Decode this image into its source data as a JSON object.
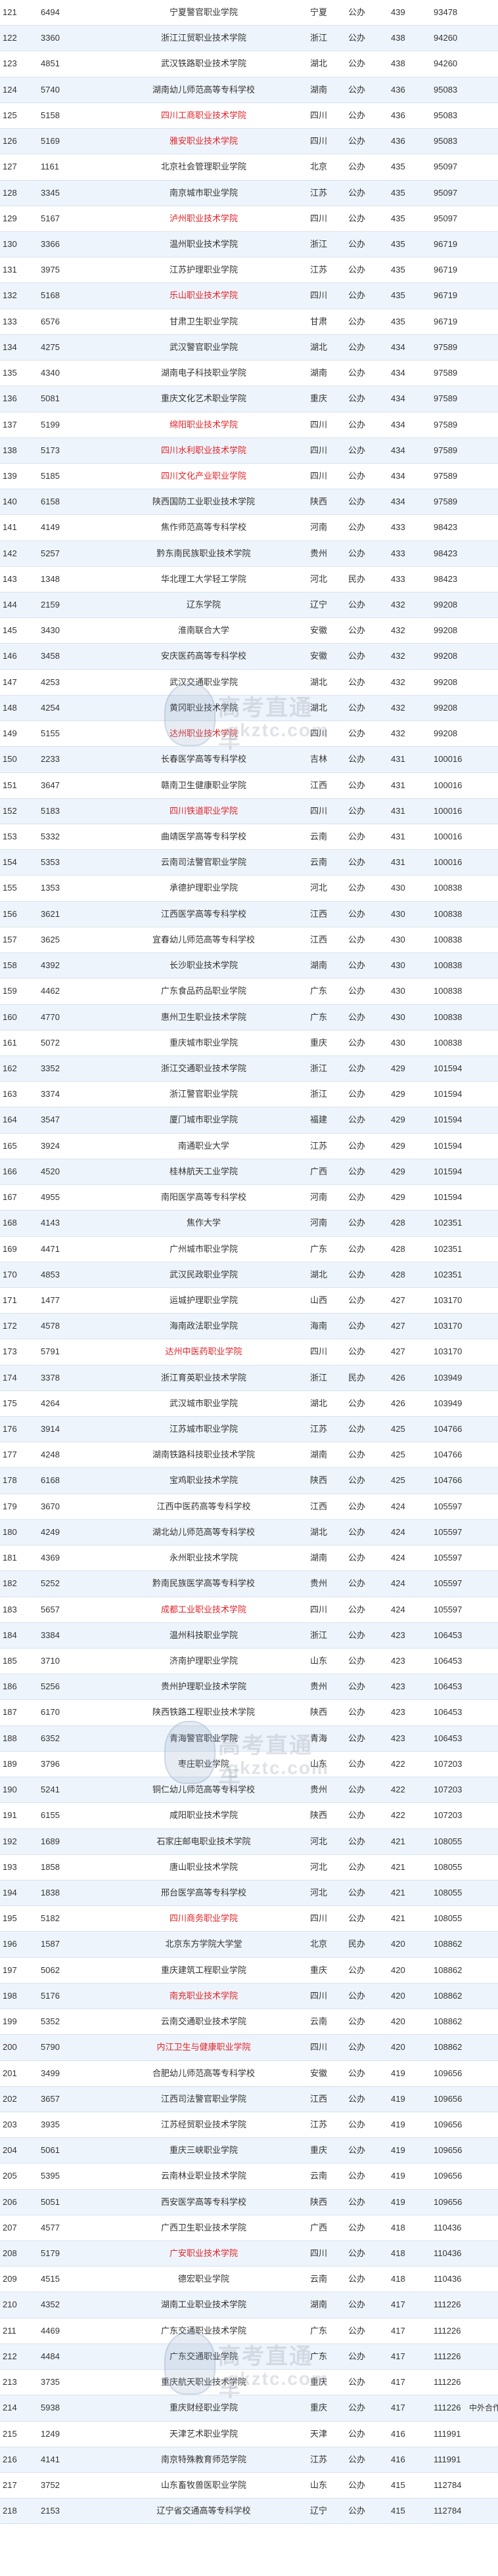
{
  "watermark": {
    "line1": "高考直通车",
    "line2": "gkztc.com"
  },
  "rows": [
    [
      "121",
      "6494",
      "宁夏警官职业学院",
      "宁夏",
      "公办",
      "439",
      "93478",
      "",
      false
    ],
    [
      "122",
      "3360",
      "浙江江贸职业技术学院",
      "浙江",
      "公办",
      "438",
      "94260",
      "",
      false
    ],
    [
      "123",
      "4851",
      "武汉铁路职业技术学院",
      "湖北",
      "公办",
      "438",
      "94260",
      "",
      false
    ],
    [
      "124",
      "5740",
      "湖南幼儿师范高等专科学校",
      "湖南",
      "公办",
      "436",
      "95083",
      "",
      false
    ],
    [
      "125",
      "5158",
      "四川工商职业技术学院",
      "四川",
      "公办",
      "436",
      "95083",
      "",
      true
    ],
    [
      "126",
      "5169",
      "雅安职业技术学院",
      "四川",
      "公办",
      "436",
      "95083",
      "",
      true
    ],
    [
      "127",
      "1161",
      "北京社会管理职业学院",
      "北京",
      "公办",
      "435",
      "95097",
      "",
      false
    ],
    [
      "128",
      "3345",
      "南京城市职业学院",
      "江苏",
      "公办",
      "435",
      "95097",
      "",
      false
    ],
    [
      "129",
      "5167",
      "泸州职业技术学院",
      "四川",
      "公办",
      "435",
      "95097",
      "",
      true
    ],
    [
      "130",
      "3366",
      "温州职业技术学院",
      "浙江",
      "公办",
      "435",
      "96719",
      "",
      false
    ],
    [
      "131",
      "3975",
      "江苏护理职业学院",
      "江苏",
      "公办",
      "435",
      "96719",
      "",
      false
    ],
    [
      "132",
      "5168",
      "乐山职业技术学院",
      "四川",
      "公办",
      "435",
      "96719",
      "",
      true
    ],
    [
      "133",
      "6576",
      "甘肃卫生职业学院",
      "甘肃",
      "公办",
      "435",
      "96719",
      "",
      false
    ],
    [
      "134",
      "4275",
      "武汉警官职业学院",
      "湖北",
      "公办",
      "434",
      "97589",
      "",
      false
    ],
    [
      "135",
      "4340",
      "湖南电子科技职业学院",
      "湖南",
      "公办",
      "434",
      "97589",
      "",
      false
    ],
    [
      "136",
      "5081",
      "重庆文化艺术职业学院",
      "重庆",
      "公办",
      "434",
      "97589",
      "",
      false
    ],
    [
      "137",
      "5199",
      "绵阳职业技术学院",
      "四川",
      "公办",
      "434",
      "97589",
      "",
      true
    ],
    [
      "138",
      "5173",
      "四川水利职业技术学院",
      "四川",
      "公办",
      "434",
      "97589",
      "",
      true
    ],
    [
      "139",
      "5185",
      "四川文化产业职业学院",
      "四川",
      "公办",
      "434",
      "97589",
      "",
      true
    ],
    [
      "140",
      "6158",
      "陕西国防工业职业技术学院",
      "陕西",
      "公办",
      "434",
      "97589",
      "",
      false
    ],
    [
      "141",
      "4149",
      "焦作师范高等专科学校",
      "河南",
      "公办",
      "433",
      "98423",
      "",
      false
    ],
    [
      "142",
      "5257",
      "黔东南民族职业技术学院",
      "贵州",
      "公办",
      "433",
      "98423",
      "",
      false
    ],
    [
      "143",
      "1348",
      "华北理工大学轻工学院",
      "河北",
      "民办",
      "433",
      "98423",
      "",
      false
    ],
    [
      "144",
      "2159",
      "辽东学院",
      "辽宁",
      "公办",
      "432",
      "99208",
      "",
      false
    ],
    [
      "145",
      "3430",
      "淮南联合大学",
      "安徽",
      "公办",
      "432",
      "99208",
      "",
      false
    ],
    [
      "146",
      "3458",
      "安庆医药高等专科学校",
      "安徽",
      "公办",
      "432",
      "99208",
      "",
      false
    ],
    [
      "147",
      "4253",
      "武汉交通职业学院",
      "湖北",
      "公办",
      "432",
      "99208",
      "",
      false
    ],
    [
      "148",
      "4254",
      "黄冈职业技术学院",
      "湖北",
      "公办",
      "432",
      "99208",
      "",
      false
    ],
    [
      "149",
      "5155",
      "达州职业技术学院",
      "四川",
      "公办",
      "432",
      "99208",
      "",
      true
    ],
    [
      "150",
      "2233",
      "长春医学高等专科学校",
      "吉林",
      "公办",
      "431",
      "100016",
      "",
      false
    ],
    [
      "151",
      "3647",
      "赣南卫生健康职业学院",
      "江西",
      "公办",
      "431",
      "100016",
      "",
      false
    ],
    [
      "152",
      "5183",
      "四川铁道职业学院",
      "四川",
      "公办",
      "431",
      "100016",
      "",
      true
    ],
    [
      "153",
      "5332",
      "曲靖医学高等专科学校",
      "云南",
      "公办",
      "431",
      "100016",
      "",
      false
    ],
    [
      "154",
      "5353",
      "云南司法警官职业学院",
      "云南",
      "公办",
      "431",
      "100016",
      "",
      false
    ],
    [
      "155",
      "1353",
      "承德护理职业学院",
      "河北",
      "公办",
      "430",
      "100838",
      "",
      false
    ],
    [
      "156",
      "3621",
      "江西医学高等专科学校",
      "江西",
      "公办",
      "430",
      "100838",
      "",
      false
    ],
    [
      "157",
      "3625",
      "宜春幼儿师范高等专科学校",
      "江西",
      "公办",
      "430",
      "100838",
      "",
      false
    ],
    [
      "158",
      "4392",
      "长沙职业技术学院",
      "湖南",
      "公办",
      "430",
      "100838",
      "",
      false
    ],
    [
      "159",
      "4462",
      "广东食品药品职业学院",
      "广东",
      "公办",
      "430",
      "100838",
      "",
      false
    ],
    [
      "160",
      "4770",
      "惠州卫生职业技术学院",
      "广东",
      "公办",
      "430",
      "100838",
      "",
      false
    ],
    [
      "161",
      "5072",
      "重庆城市职业学院",
      "重庆",
      "公办",
      "430",
      "100838",
      "",
      false
    ],
    [
      "162",
      "3352",
      "浙江交通职业技术学院",
      "浙江",
      "公办",
      "429",
      "101594",
      "",
      false
    ],
    [
      "163",
      "3374",
      "浙江警官职业学院",
      "浙江",
      "公办",
      "429",
      "101594",
      "",
      false
    ],
    [
      "164",
      "3547",
      "厦门城市职业学院",
      "福建",
      "公办",
      "429",
      "101594",
      "",
      false
    ],
    [
      "165",
      "3924",
      "南通职业大学",
      "江苏",
      "公办",
      "429",
      "101594",
      "",
      false
    ],
    [
      "166",
      "4520",
      "桂林航天工业学院",
      "广西",
      "公办",
      "429",
      "101594",
      "",
      false
    ],
    [
      "167",
      "4955",
      "南阳医学高等专科学校",
      "河南",
      "公办",
      "429",
      "101594",
      "",
      false
    ],
    [
      "168",
      "4143",
      "焦作大学",
      "河南",
      "公办",
      "428",
      "102351",
      "",
      false
    ],
    [
      "169",
      "4471",
      "广州城市职业学院",
      "广东",
      "公办",
      "428",
      "102351",
      "",
      false
    ],
    [
      "170",
      "4853",
      "武汉民政职业学院",
      "湖北",
      "公办",
      "428",
      "102351",
      "",
      false
    ],
    [
      "171",
      "1477",
      "运城护理职业学院",
      "山西",
      "公办",
      "427",
      "103170",
      "",
      false
    ],
    [
      "172",
      "4578",
      "海南政法职业学院",
      "海南",
      "公办",
      "427",
      "103170",
      "",
      false
    ],
    [
      "173",
      "5791",
      "达州中医药职业学院",
      "四川",
      "公办",
      "427",
      "103170",
      "",
      true
    ],
    [
      "174",
      "3378",
      "浙江育英职业技术学院",
      "浙江",
      "民办",
      "426",
      "103949",
      "",
      false
    ],
    [
      "175",
      "4264",
      "武汉城市职业学院",
      "湖北",
      "公办",
      "426",
      "103949",
      "",
      false
    ],
    [
      "176",
      "3914",
      "江苏城市职业学院",
      "江苏",
      "公办",
      "425",
      "104766",
      "",
      false
    ],
    [
      "177",
      "4248",
      "湖南铁路科技职业技术学院",
      "湖南",
      "公办",
      "425",
      "104766",
      "",
      false
    ],
    [
      "178",
      "6168",
      "宝鸡职业技术学院",
      "陕西",
      "公办",
      "425",
      "104766",
      "",
      false
    ],
    [
      "179",
      "3670",
      "江西中医药高等专科学校",
      "江西",
      "公办",
      "424",
      "105597",
      "",
      false
    ],
    [
      "180",
      "4249",
      "湖北幼儿师范高等专科学校",
      "湖北",
      "公办",
      "424",
      "105597",
      "",
      false
    ],
    [
      "181",
      "4369",
      "永州职业技术学院",
      "湖南",
      "公办",
      "424",
      "105597",
      "",
      false
    ],
    [
      "182",
      "5252",
      "黔南民族医学高等专科学校",
      "贵州",
      "公办",
      "424",
      "105597",
      "",
      false
    ],
    [
      "183",
      "5657",
      "成都工业职业技术学院",
      "四川",
      "公办",
      "424",
      "105597",
      "",
      true
    ],
    [
      "184",
      "3384",
      "温州科技职业学院",
      "浙江",
      "公办",
      "423",
      "106453",
      "",
      false
    ],
    [
      "185",
      "3710",
      "济南护理职业学院",
      "山东",
      "公办",
      "423",
      "106453",
      "",
      false
    ],
    [
      "186",
      "5256",
      "贵州护理职业技术学院",
      "贵州",
      "公办",
      "423",
      "106453",
      "",
      false
    ],
    [
      "187",
      "6170",
      "陕西铁路工程职业技术学院",
      "陕西",
      "公办",
      "423",
      "106453",
      "",
      false
    ],
    [
      "188",
      "6352",
      "青海警官职业学院",
      "青海",
      "公办",
      "423",
      "106453",
      "",
      false
    ],
    [
      "189",
      "3796",
      "枣庄职业学院",
      "山东",
      "公办",
      "422",
      "107203",
      "",
      false
    ],
    [
      "190",
      "5241",
      "铜仁幼儿师范高等专科学校",
      "贵州",
      "公办",
      "422",
      "107203",
      "",
      false
    ],
    [
      "191",
      "6155",
      "咸阳职业技术学院",
      "陕西",
      "公办",
      "422",
      "107203",
      "",
      false
    ],
    [
      "192",
      "1689",
      "石家庄邮电职业技术学院",
      "河北",
      "公办",
      "421",
      "108055",
      "",
      false
    ],
    [
      "193",
      "1858",
      "唐山职业技术学院",
      "河北",
      "公办",
      "421",
      "108055",
      "",
      false
    ],
    [
      "194",
      "1838",
      "邢台医学高等专科学校",
      "河北",
      "公办",
      "421",
      "108055",
      "",
      false
    ],
    [
      "195",
      "5182",
      "四川商务职业学院",
      "四川",
      "公办",
      "421",
      "108055",
      "",
      true
    ],
    [
      "196",
      "1587",
      "北京东方学院大学堂",
      "北京",
      "民办",
      "420",
      "108862",
      "",
      false
    ],
    [
      "197",
      "5062",
      "重庆建筑工程职业学院",
      "重庆",
      "公办",
      "420",
      "108862",
      "",
      false
    ],
    [
      "198",
      "5176",
      "南充职业技术学院",
      "四川",
      "公办",
      "420",
      "108862",
      "",
      true
    ],
    [
      "199",
      "5352",
      "云南交通职业技术学院",
      "云南",
      "公办",
      "420",
      "108862",
      "",
      false
    ],
    [
      "200",
      "5790",
      "内江卫生与健康职业学院",
      "四川",
      "公办",
      "420",
      "108862",
      "",
      true
    ],
    [
      "201",
      "3499",
      "合肥幼儿师范高等专科学校",
      "安徽",
      "公办",
      "419",
      "109656",
      "",
      false
    ],
    [
      "202",
      "3657",
      "江西司法警官职业学院",
      "江西",
      "公办",
      "419",
      "109656",
      "",
      false
    ],
    [
      "203",
      "3935",
      "江苏经贸职业技术学院",
      "江苏",
      "公办",
      "419",
      "109656",
      "",
      false
    ],
    [
      "204",
      "5061",
      "重庆三峡职业学院",
      "重庆",
      "公办",
      "419",
      "109656",
      "",
      false
    ],
    [
      "205",
      "5395",
      "云南林业职业技术学院",
      "云南",
      "公办",
      "419",
      "109656",
      "",
      false
    ],
    [
      "206",
      "5051",
      "西安医学高等专科学校",
      "陕西",
      "公办",
      "419",
      "109656",
      "",
      false
    ],
    [
      "207",
      "4577",
      "广西卫生职业技术学院",
      "广西",
      "公办",
      "418",
      "110436",
      "",
      false
    ],
    [
      "208",
      "5179",
      "广安职业技术学院",
      "四川",
      "公办",
      "418",
      "110436",
      "",
      true
    ],
    [
      "209",
      "4515",
      "德宏职业学院",
      "云南",
      "公办",
      "418",
      "110436",
      "",
      false
    ],
    [
      "210",
      "4352",
      "湖南工业职业技术学院",
      "湖南",
      "公办",
      "417",
      "111226",
      "",
      false
    ],
    [
      "211",
      "4469",
      "广东交通职业技术学院",
      "广东",
      "公办",
      "417",
      "111226",
      "",
      false
    ],
    [
      "212",
      "4484",
      "广东交通职业学院",
      "广东",
      "公办",
      "417",
      "111226",
      "",
      false
    ],
    [
      "213",
      "3735",
      "重庆航天职业技术学院",
      "重庆",
      "公办",
      "417",
      "111226",
      "",
      false
    ],
    [
      "214",
      "5938",
      "重庆财经职业学院",
      "重庆",
      "公办",
      "417",
      "111226",
      "中外合作办学",
      false
    ],
    [
      "215",
      "1249",
      "天津艺术职业学院",
      "天津",
      "公办",
      "416",
      "111991",
      "",
      false
    ],
    [
      "216",
      "4141",
      "南京特殊教育师范学院",
      "江苏",
      "公办",
      "416",
      "111991",
      "",
      false
    ],
    [
      "217",
      "3752",
      "山东畜牧兽医职业学院",
      "山东",
      "公办",
      "415",
      "112784",
      "",
      false
    ],
    [
      "218",
      "2153",
      "辽宁省交通高等专科学校",
      "辽宁",
      "公办",
      "415",
      "112784",
      "",
      false
    ]
  ]
}
